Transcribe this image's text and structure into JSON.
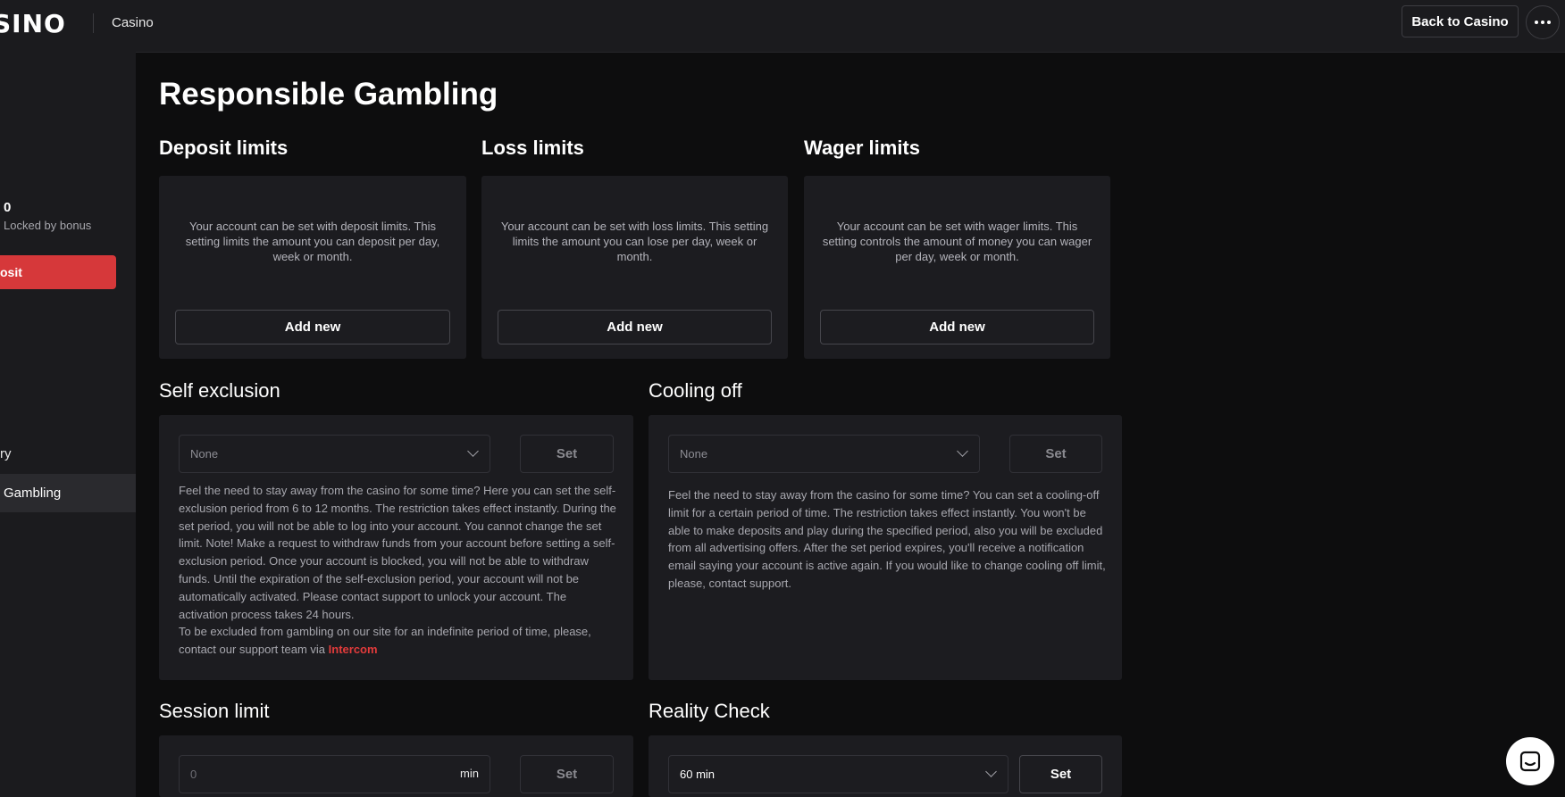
{
  "header": {
    "logo": "SINO",
    "section": "Casino",
    "back_label": "Back to Casino"
  },
  "sidebar": {
    "balance": "0",
    "locked_label": "Locked by bonus",
    "deposit_label": "osit",
    "history_label": "ry",
    "active_label": "Gambling"
  },
  "page": {
    "title": "Responsible Gambling"
  },
  "deposit": {
    "title": "Deposit limits",
    "desc": "Your account can be set with deposit limits. This setting limits the amount you can deposit per day, week or month.",
    "button": "Add new"
  },
  "loss": {
    "title": "Loss limits",
    "desc": "Your account can be set with loss limits. This setting limits the amount you can lose per day, week or month.",
    "button": "Add new"
  },
  "wager": {
    "title": "Wager limits",
    "desc": "Your account can be set with wager limits. This setting controls the amount of money you can wager per day, week or month.",
    "button": "Add new"
  },
  "self_exclusion": {
    "title": "Self exclusion",
    "select_value": "None",
    "set_label": "Set",
    "desc": "Feel the need to stay away from the casino for some time? Here you can set the self-exclusion period from 6 to 12 months. The restriction takes effect instantly. During the set period, you will not be able to log into your account. You cannot change the set limit. Note! Make a request to withdraw funds from your account before setting a self-exclusion period. Once your account is blocked, you will not be able to withdraw funds. Until the expiration of the self-exclusion period, your account will not be automatically activated. Please contact support to unlock your account. The activation process takes 24 hours.",
    "desc2": "To be excluded from gambling on our site for an indefinite period of time, please, contact our support team via ",
    "link": "Intercom"
  },
  "cooling_off": {
    "title": "Cooling off",
    "select_value": "None",
    "set_label": "Set",
    "desc": "Feel the need to stay away from the casino for some time? You can set a cooling-off limit for a certain period of time. The restriction takes effect instantly. You won't be able to make deposits and play during the specified period, also you will be excluded from all advertising offers. After the set period expires, you'll receive a notification email saying your account is active again. If you would like to change cooling off limit, please, contact support."
  },
  "session_limit": {
    "title": "Session limit",
    "placeholder": "0",
    "unit": "min",
    "set_label": "Set"
  },
  "reality_check": {
    "title": "Reality Check",
    "select_value": "60 min",
    "set_label": "Set"
  }
}
